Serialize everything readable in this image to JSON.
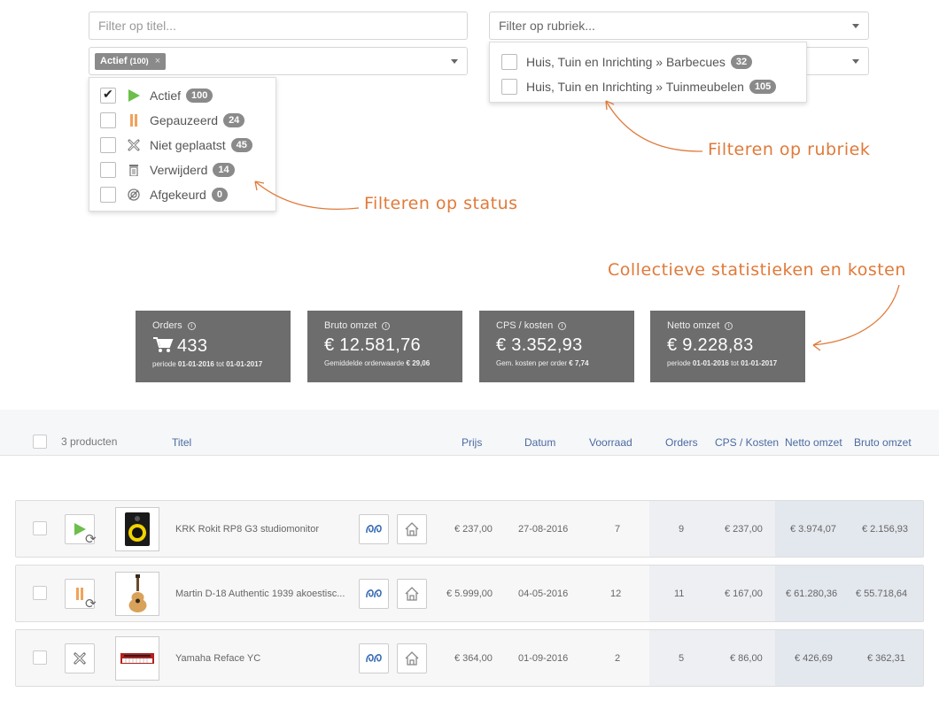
{
  "filters": {
    "title_placeholder": "Filter op titel...",
    "category_placeholder": "Filter op rubriek...",
    "status_tag": {
      "label": "Actief",
      "count": "(100)",
      "remove": "×"
    }
  },
  "status_dropdown": [
    {
      "label": "Actief",
      "count": "100",
      "checked": true,
      "icon": "play-icon"
    },
    {
      "label": "Gepauzeerd",
      "count": "24",
      "checked": false,
      "icon": "pause-icon"
    },
    {
      "label": "Niet geplaatst",
      "count": "45",
      "checked": false,
      "icon": "not-placed-icon"
    },
    {
      "label": "Verwijderd",
      "count": "14",
      "checked": false,
      "icon": "trash-icon"
    },
    {
      "label": "Afgekeurd",
      "count": "0",
      "checked": false,
      "icon": "rejected-icon"
    }
  ],
  "category_dropdown": [
    {
      "label": "Huis, Tuin en Inrichting » Barbecues",
      "count": "32"
    },
    {
      "label": "Huis, Tuin en Inrichting » Tuinmeubelen",
      "count": "105"
    }
  ],
  "annotations": {
    "status": "Filteren op status",
    "category": "Filteren op rubriek",
    "stats": "Collectieve statistieken en kosten"
  },
  "stats": [
    {
      "label": "Orders",
      "value": "433",
      "icon": "cart-icon",
      "sub_prefix": "periode",
      "sub_a": "01-01-2016",
      "sub_mid": "tot",
      "sub_b": "01-01-2017"
    },
    {
      "label": "Bruto omzet",
      "value": "€ 12.581,76",
      "sub_prefix": "Gemiddelde orderwaarde",
      "sub_a": "€ 29,06"
    },
    {
      "label": "CPS / kosten",
      "value": "€ 3.352,93",
      "sub_prefix": "Gem. kosten per order",
      "sub_a": "€ 7,74"
    },
    {
      "label": "Netto omzet",
      "value": "€ 9.228,83",
      "sub_prefix": "periode",
      "sub_a": "01-01-2016",
      "sub_mid": "tot",
      "sub_b": "01-01-2017"
    }
  ],
  "table": {
    "count_label": "3 producten",
    "columns": {
      "title": "Titel",
      "price": "Prijs",
      "date": "Datum",
      "stock": "Voorraad",
      "orders": "Orders",
      "cps": "CPS / Kosten",
      "net": "Netto omzet",
      "gross": "Bruto omzet"
    },
    "rows": [
      {
        "status": "play-icon",
        "synced": true,
        "thumb": "studio-monitor-image",
        "title": "KRK Rokit RP8 G3 studiomonitor",
        "price": "€ 237,00",
        "date": "27-08-2016",
        "stock": "7",
        "orders": "9",
        "cps": "€ 237,00",
        "net": "€ 3.974,07",
        "gross": "€ 2.156,93"
      },
      {
        "status": "pause-icon",
        "synced": true,
        "thumb": "guitar-image",
        "title": "Martin D-18 Authentic 1939 akoestisc...",
        "price": "€ 5.999,00",
        "date": "04-05-2016",
        "stock": "12",
        "orders": "11",
        "cps": "€ 167,00",
        "net": "€ 61.280,36",
        "gross": "€ 55.718,64"
      },
      {
        "status": "not-placed-icon",
        "synced": false,
        "thumb": "keyboard-image",
        "title": "Yamaha Reface YC",
        "price": "€ 364,00",
        "date": "01-09-2016",
        "stock": "2",
        "orders": "5",
        "cps": "€ 86,00",
        "net": "€ 426,69",
        "gross": "€ 362,31"
      }
    ]
  },
  "colors": {
    "accent": "#e07a3a",
    "active": "#6cbf4b",
    "paused": "#f0a35a",
    "link": "#4b6aa0",
    "stat_bg": "#6d6d6d"
  }
}
